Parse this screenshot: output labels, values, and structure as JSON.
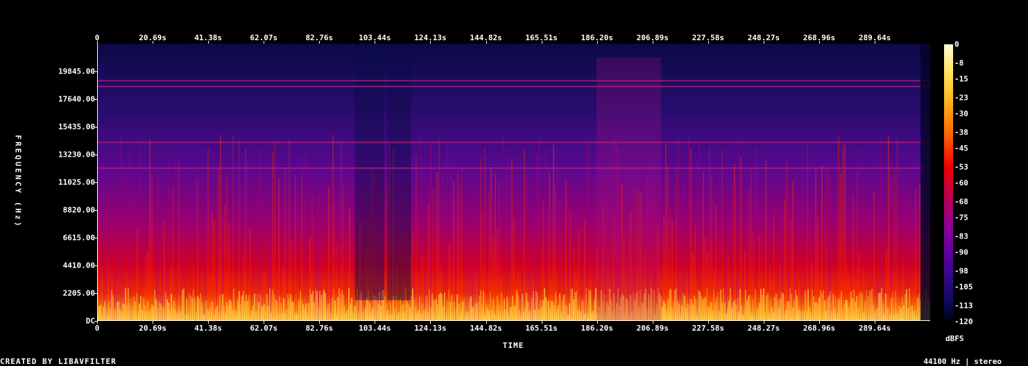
{
  "chart_data": {
    "type": "heatmap",
    "title": "",
    "xlabel": "TIME",
    "ylabel": "FREQUENCY (Hz)",
    "x_ticks": [
      "0",
      "20.69s",
      "41.38s",
      "62.07s",
      "82.76s",
      "103.44s",
      "124.13s",
      "144.82s",
      "165.51s",
      "186.20s",
      "206.89s",
      "227.58s",
      "248.27s",
      "268.96s",
      "289.64s"
    ],
    "x_tick_values": [
      0,
      20.69,
      41.38,
      62.07,
      82.76,
      103.44,
      124.13,
      144.82,
      165.51,
      186.2,
      206.89,
      227.58,
      248.27,
      268.96,
      289.64
    ],
    "xlim": [
      0,
      310.3
    ],
    "y_ticks": [
      "DC",
      "2205.00",
      "4410.00",
      "6615.00",
      "8820.00",
      "11025.00",
      "13230.00",
      "15435.00",
      "17640.00",
      "19845.00"
    ],
    "y_tick_values": [
      0,
      2205,
      4410,
      6615,
      8820,
      11025,
      13230,
      15435,
      17640,
      19845
    ],
    "ylim": [
      0,
      22050
    ],
    "colorbar": {
      "label": "dBFS",
      "ticks": [
        "0",
        "-8",
        "-15",
        "-23",
        "-30",
        "-38",
        "-45",
        "-53",
        "-60",
        "-68",
        "-75",
        "-83",
        "-90",
        "-98",
        "-105",
        "-113",
        "-120"
      ],
      "tick_values": [
        0,
        -8,
        -15,
        -23,
        -30,
        -38,
        -45,
        -53,
        -60,
        -68,
        -75,
        -83,
        -90,
        -98,
        -105,
        -113,
        -120
      ],
      "range": [
        -120,
        0
      ]
    },
    "quiet_segments_s": [
      [
        96,
        107
      ],
      [
        108,
        117
      ]
    ],
    "bright_segments_s": [
      [
        186,
        210
      ]
    ],
    "steady_tones_hz": [
      19100,
      18650,
      14200,
      12150
    ]
  },
  "footer": {
    "credit": "CREATED BY LIBAVFILTER",
    "info": "44100 Hz | stereo"
  }
}
